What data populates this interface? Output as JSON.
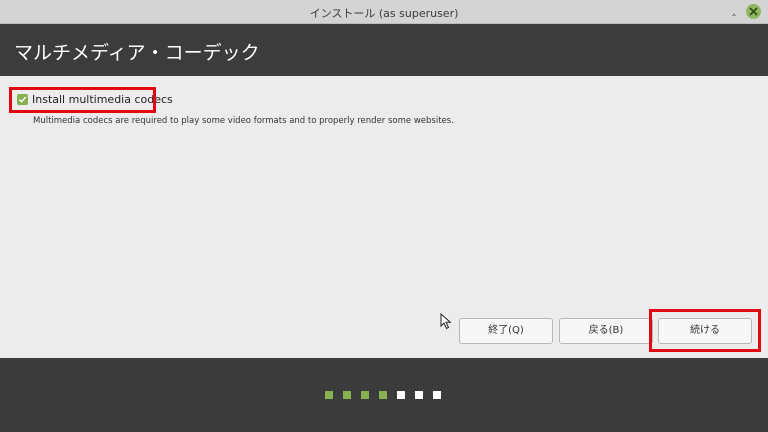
{
  "window": {
    "title": "インストール (as superuser)"
  },
  "header": {
    "title": "マルチメディア・コーデック"
  },
  "codecs": {
    "checkbox_label": "Install multimedia codecs",
    "checked": true,
    "description": "Multimedia codecs are required to play some video formats and to properly render some websites."
  },
  "buttons": {
    "quit": "終了(Q)",
    "back": "戻る(B)",
    "continue": "続ける"
  },
  "progress": {
    "total_steps": 7,
    "completed_steps": 4
  },
  "colors": {
    "header_bg": "#3c3c3c",
    "accent": "#87b04f",
    "highlight": "#e30613",
    "dot_done": "#87b04f",
    "dot_todo": "#ffffff"
  }
}
